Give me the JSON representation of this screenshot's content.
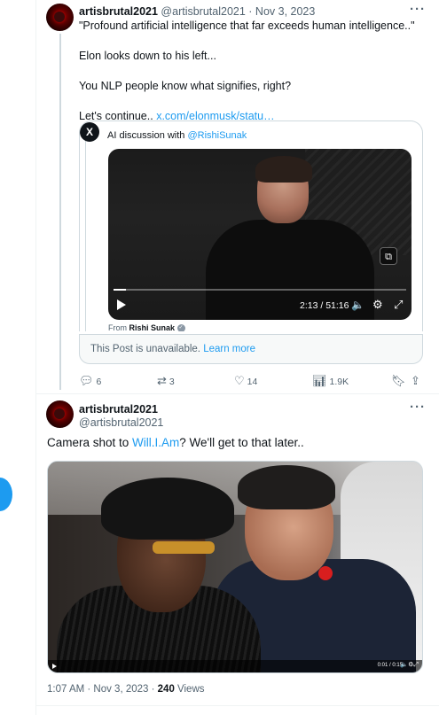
{
  "tweet1": {
    "display_name": "artisbrutal2021",
    "handle": "@artisbrutal2021",
    "separator": " · ",
    "date": "Nov 3, 2023",
    "more": "···",
    "lines": [
      "\"Profound artificial intelligence that far exceeds human intelligence..\"",
      "Elon looks down to his left...",
      "You NLP people know what signifies, right?"
    ],
    "continue_text": "Let's continue..",
    "continue_link": "x.com/elonmusk/statu…",
    "quote": {
      "logo": "X",
      "title_prefix": "AI discussion with ",
      "title_mention": "@RishiSunak",
      "video_time": "2:13 / 51:16",
      "from_prefix": "From ",
      "from_name": "Rishi Sunak",
      "progress": 0.043
    },
    "unavailable_text": "This Post is unavailable. ",
    "unavailable_link": "Learn more",
    "actions": {
      "replies": "6",
      "reposts": "3",
      "likes": "14",
      "views": "1.9K"
    }
  },
  "tweet2": {
    "display_name": "artisbrutal2021",
    "handle": "@artisbrutal2021",
    "more": "···",
    "text_before": "Camera shot to ",
    "text_mention": "Will.I.Am",
    "text_after": "?  We'll get to that later..",
    "video_time": "0:01 / 0:15",
    "footer_time": "1:07 AM · Nov 3, 2023 · ",
    "footer_views_count": "240",
    "footer_views_label": " Views"
  },
  "colors": {
    "accent": "#1d9bf0",
    "text": "#0f1419",
    "muted": "#536471"
  }
}
